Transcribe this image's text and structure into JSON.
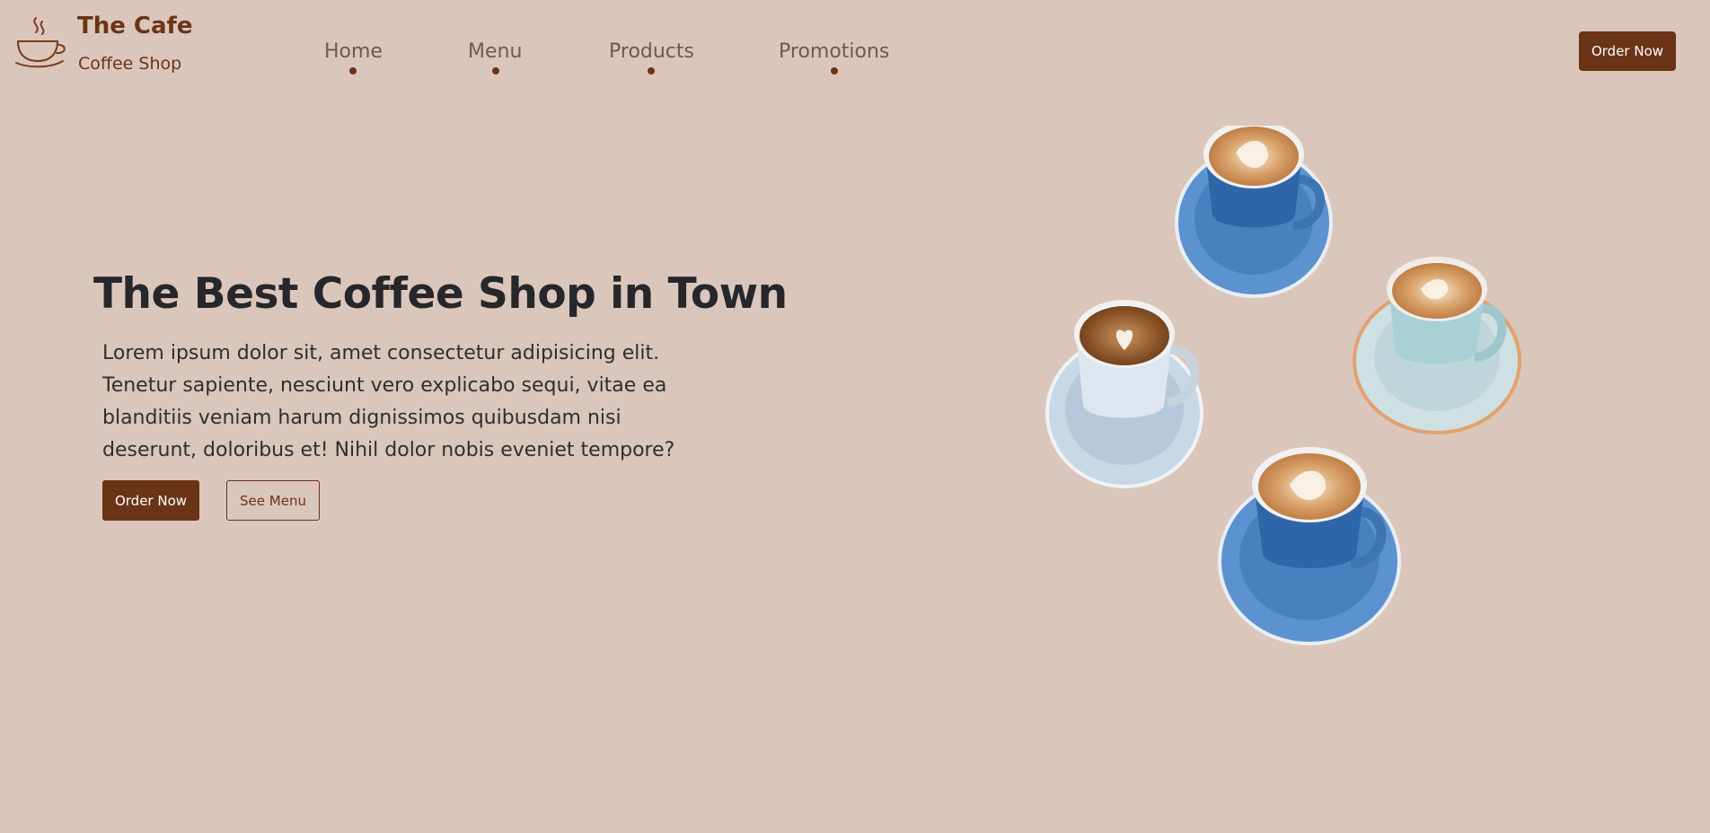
{
  "header": {
    "brand_title": "The Cafe",
    "brand_subtitle": "Coffee Shop",
    "logo_icon": "coffee-cup-icon",
    "nav": [
      {
        "label": "Home"
      },
      {
        "label": "Menu"
      },
      {
        "label": "Products"
      },
      {
        "label": "Promotions"
      }
    ],
    "order_button": "Order Now"
  },
  "hero": {
    "title": "The Best Coffee Shop in Town",
    "description": "Lorem ipsum dolor sit, amet consectetur adipisicing elit. Tenetur sapiente, nesciunt vero explicabo sequi, vitae ea blanditiis veniam harum dignissimos quibusdam nisi deserunt, doloribus et! Nihil dolor nobis eveniet tempore?",
    "primary_button": "Order Now",
    "secondary_button": "See Menu",
    "image_icon": "latte-cups-image"
  },
  "colors": {
    "background": "#dbc6bb",
    "brand": "#6b3417",
    "text": "#25272b",
    "nav_text": "#6d5a52"
  }
}
